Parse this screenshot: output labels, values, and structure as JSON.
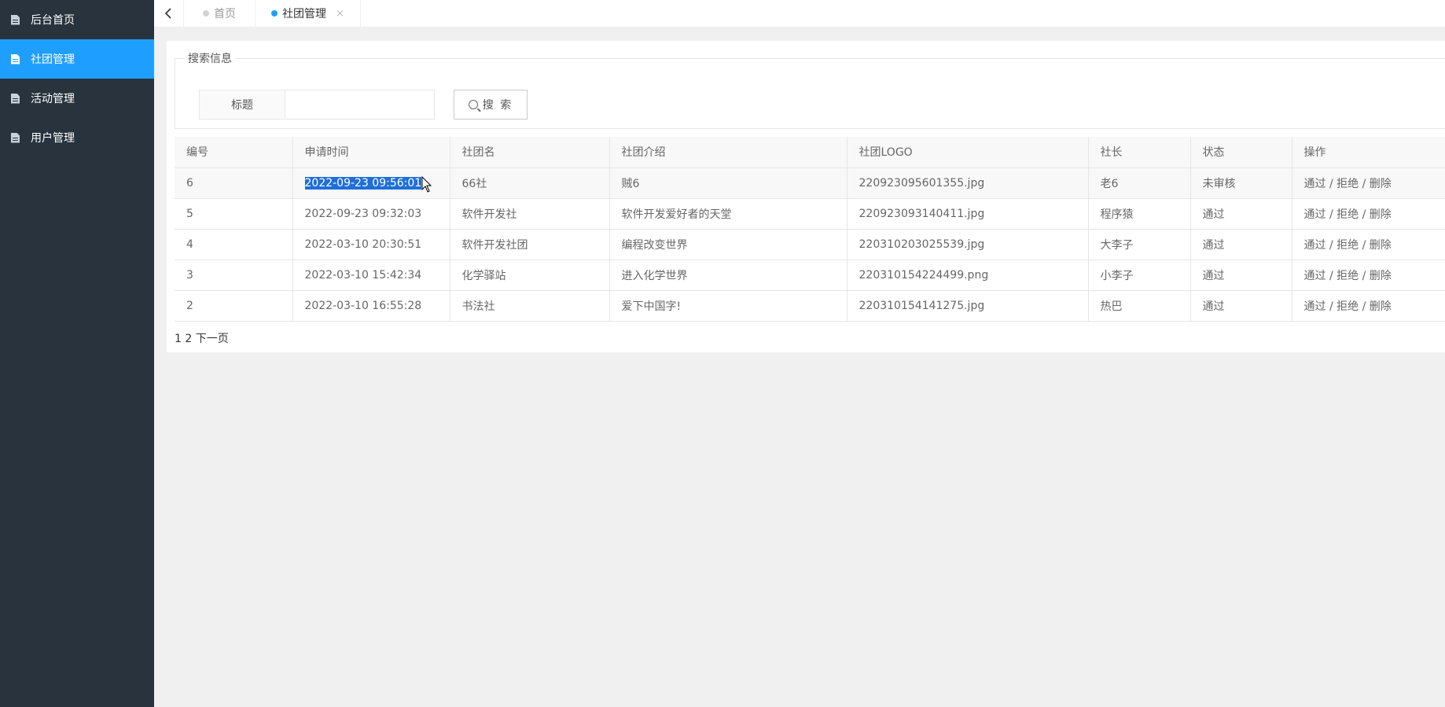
{
  "sidebar": {
    "items": [
      {
        "label": "后台首页"
      },
      {
        "label": "社团管理"
      },
      {
        "label": "活动管理"
      },
      {
        "label": "用户管理"
      }
    ]
  },
  "tabs": {
    "home": "首页",
    "current": "社团管理",
    "close": "×"
  },
  "search": {
    "legend": "搜索信息",
    "field_label": "标题",
    "input_value": "",
    "button_label": "搜 索"
  },
  "table": {
    "headers": [
      "编号",
      "申请时间",
      "社团名",
      "社团介绍",
      "社团LOGO",
      "社长",
      "状态",
      "操作"
    ],
    "rows": [
      [
        "6",
        "2022-09-23 09:56:01",
        "66社",
        "贼6",
        "220923095601355.jpg",
        "老6",
        "未审核"
      ],
      [
        "5",
        "2022-09-23 09:32:03",
        "软件开发社",
        "软件开发爱好者的天堂",
        "220923093140411.jpg",
        "程序猿",
        "通过"
      ],
      [
        "4",
        "2022-03-10 20:30:51",
        "软件开发社团",
        "编程改变世界",
        "220310203025539.jpg",
        "大李子",
        "通过"
      ],
      [
        "3",
        "2022-03-10 15:42:34",
        "化学驿站",
        "进入化学世界",
        "220310154224499.png",
        "小李子",
        "通过"
      ],
      [
        "2",
        "2022-03-10 16:55:28",
        "书法社",
        "爱下中国字!",
        "220310154141275.jpg",
        "热巴",
        "通过"
      ]
    ],
    "ops": {
      "approve": "通过",
      "reject": "拒绝",
      "delete": "删除",
      "sep": " / "
    }
  },
  "pager": {
    "p1": "1",
    "p2": "2",
    "next": "下一页"
  },
  "colors": {
    "sidebar_bg": "#28333e",
    "accent": "#1e9fff",
    "selection": "#1e6fd9"
  }
}
